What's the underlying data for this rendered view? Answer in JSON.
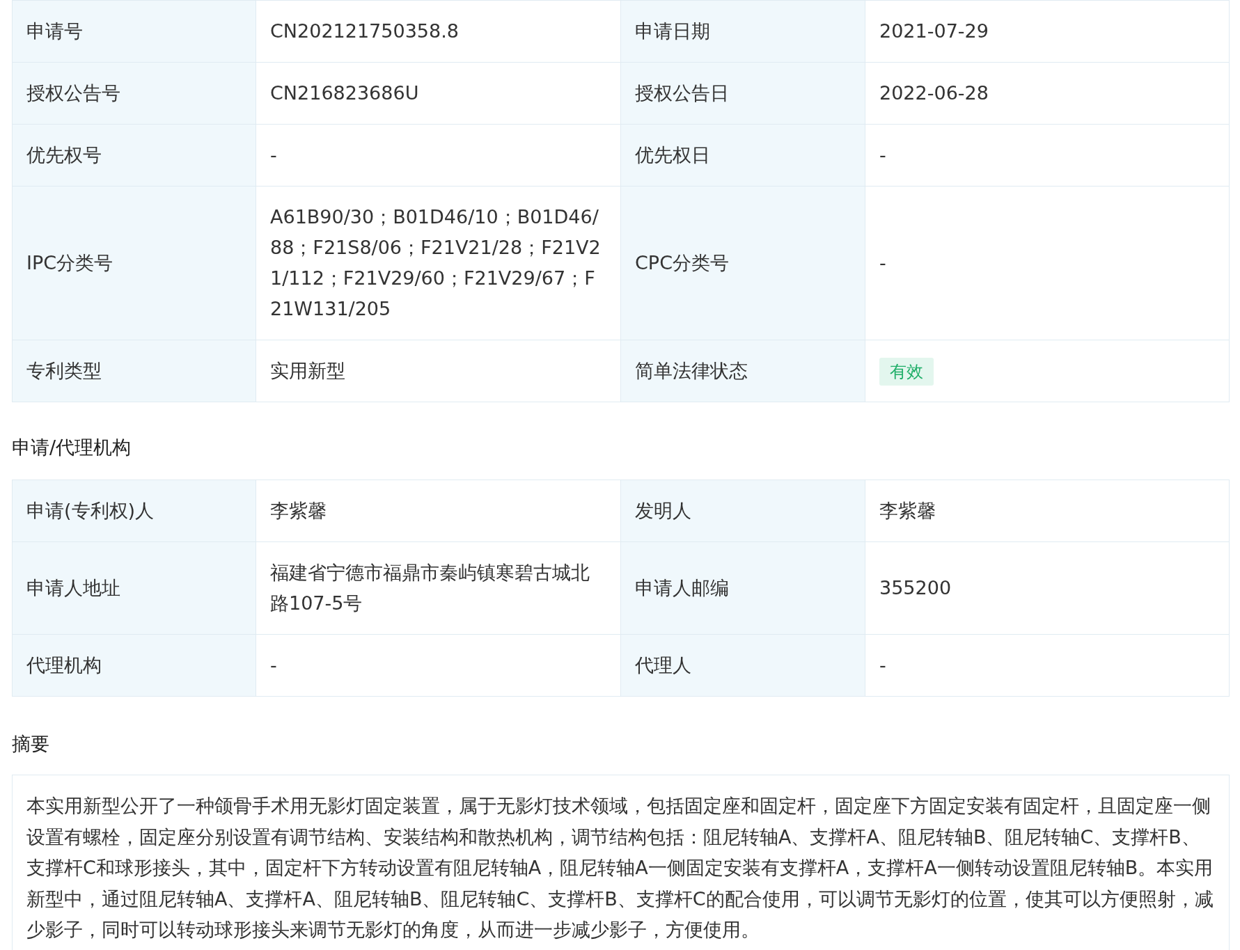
{
  "basic_info": {
    "rows": [
      {
        "fields": [
          {
            "label": "申请号",
            "value": "CN202121750358.8",
            "kind": "text"
          },
          {
            "label": "申请日期",
            "value": "2021-07-29",
            "kind": "text"
          }
        ]
      },
      {
        "fields": [
          {
            "label": "授权公告号",
            "value": "CN216823686U",
            "kind": "text"
          },
          {
            "label": "授权公告日",
            "value": "2022-06-28",
            "kind": "text"
          }
        ]
      },
      {
        "fields": [
          {
            "label": "优先权号",
            "value": "-",
            "kind": "text"
          },
          {
            "label": "优先权日",
            "value": "-",
            "kind": "text"
          }
        ]
      },
      {
        "fields": [
          {
            "label": "IPC分类号",
            "value": "A61B90/30；B01D46/10；B01D46/88；F21S8/06；F21V21/28；F21V21/112；F21V29/60；F21V29/67；F21W131/205",
            "kind": "text"
          },
          {
            "label": "CPC分类号",
            "value": "-",
            "kind": "text"
          }
        ]
      },
      {
        "fields": [
          {
            "label": "专利类型",
            "value": "实用新型",
            "kind": "text"
          },
          {
            "label": "简单法律状态",
            "value": "有效",
            "kind": "badge"
          }
        ]
      }
    ]
  },
  "agency": {
    "title": "申请/代理机构",
    "rows": [
      {
        "fields": [
          {
            "label": "申请(专利权)人",
            "value": "李紫馨",
            "kind": "text"
          },
          {
            "label": "发明人",
            "value": "李紫馨",
            "kind": "text"
          }
        ]
      },
      {
        "fields": [
          {
            "label": "申请人地址",
            "value": "福建省宁德市福鼎市秦屿镇寒碧古城北路107-5号",
            "kind": "text"
          },
          {
            "label": "申请人邮编",
            "value": "355200",
            "kind": "text"
          }
        ]
      },
      {
        "fields": [
          {
            "label": "代理机构",
            "value": "-",
            "kind": "text"
          },
          {
            "label": "代理人",
            "value": "-",
            "kind": "text"
          }
        ]
      }
    ]
  },
  "abstract": {
    "title": "摘要",
    "text": "本实用新型公开了一种颌骨手术用无影灯固定装置，属于无影灯技术领域，包括固定座和固定杆，固定座下方固定安装有固定杆，且固定座一侧设置有螺栓，固定座分别设置有调节结构、安装结构和散热机构，调节结构包括：阻尼转轴A、支撑杆A、阻尼转轴B、阻尼转轴C、支撑杆B、支撑杆C和球形接头，其中，固定杆下方转动设置有阻尼转轴A，阻尼转轴A一侧固定安装有支撑杆A，支撑杆A一侧转动设置阻尼转轴B。本实用新型中，通过阻尼转轴A、支撑杆A、阻尼转轴B、阻尼转轴C、支撑杆B、支撑杆C的配合使用，可以调节无影灯的位置，使其可以方便照射，减少影子，同时可以转动球形接头来调节无影灯的角度，从而进一步减少影子，方便使用。"
  }
}
